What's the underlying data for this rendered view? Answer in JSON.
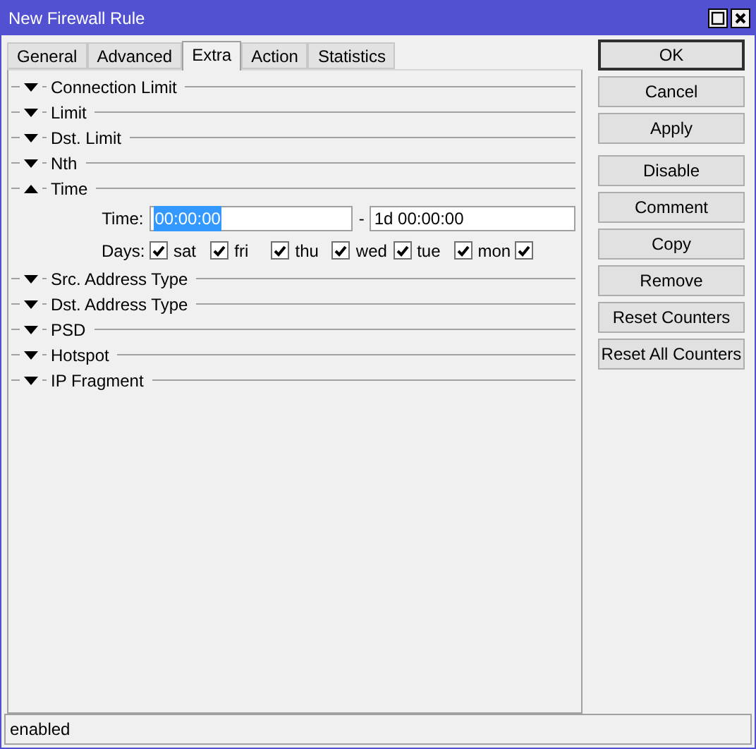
{
  "window": {
    "title": "New Firewall Rule"
  },
  "tabs": [
    {
      "label": "General",
      "selected": false
    },
    {
      "label": "Advanced",
      "selected": false
    },
    {
      "label": "Extra",
      "selected": true
    },
    {
      "label": "Action",
      "selected": false
    },
    {
      "label": "Statistics",
      "selected": false
    }
  ],
  "sections": [
    {
      "label": "Connection Limit",
      "expanded": false
    },
    {
      "label": "Limit",
      "expanded": false
    },
    {
      "label": "Dst. Limit",
      "expanded": false
    },
    {
      "label": "Nth",
      "expanded": false
    },
    {
      "label": "Time",
      "expanded": true,
      "time_label": "Time:",
      "time_from": {
        "value": "00:00:00",
        "selected": true
      },
      "separator": "-",
      "time_to": {
        "value": "1d 00:00:00",
        "selected": false
      },
      "days_label": "Days:",
      "days": [
        {
          "label": "sat",
          "checked": true
        },
        {
          "label": "fri",
          "checked": true
        },
        {
          "label": "thu",
          "checked": true
        },
        {
          "label": "wed",
          "checked": true
        },
        {
          "label": "tue",
          "checked": true
        },
        {
          "label": "mon",
          "checked": true
        },
        {
          "checked": true
        }
      ]
    },
    {
      "label": "Src. Address Type",
      "expanded": false
    },
    {
      "label": "Dst. Address Type",
      "expanded": false
    },
    {
      "label": "PSD",
      "expanded": false
    },
    {
      "label": "Hotspot",
      "expanded": false
    },
    {
      "label": "IP Fragment",
      "expanded": false
    }
  ],
  "button_groups": [
    [
      {
        "label": "OK",
        "default": true
      },
      {
        "label": "Cancel",
        "default": false
      },
      {
        "label": "Apply",
        "default": false
      }
    ],
    [
      {
        "label": "Disable",
        "default": false
      },
      {
        "label": "Comment",
        "default": false
      },
      {
        "label": "Copy",
        "default": false
      },
      {
        "label": "Remove",
        "default": false
      },
      {
        "label": "Reset Counters",
        "default": false
      },
      {
        "label": "Reset All Counters",
        "default": false
      }
    ]
  ],
  "status_bar": {
    "text": "enabled"
  }
}
